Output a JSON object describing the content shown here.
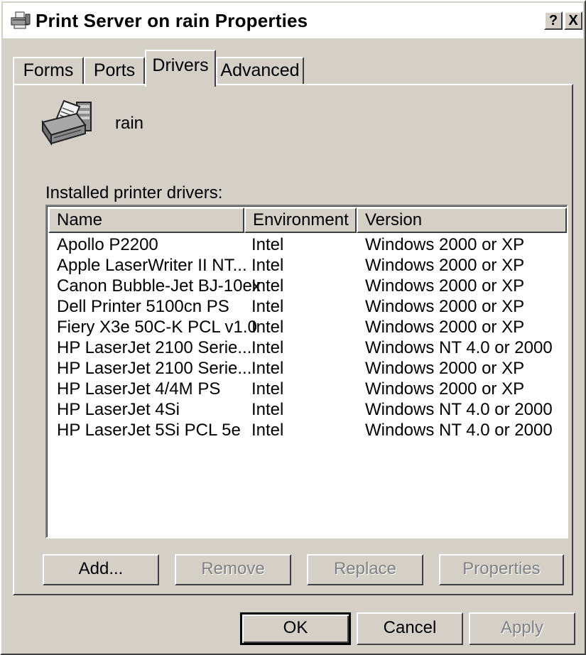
{
  "window": {
    "title": "Print Server on rain Properties",
    "help_label": "?",
    "close_label": "X"
  },
  "tabs": [
    {
      "label": "Forms",
      "active": false
    },
    {
      "label": "Ports",
      "active": false
    },
    {
      "label": "Drivers",
      "active": true
    },
    {
      "label": "Advanced",
      "active": false
    }
  ],
  "server": {
    "name": "rain"
  },
  "drivers": {
    "label": "Installed printer drivers:",
    "columns": [
      "Name",
      "Environment",
      "Version"
    ],
    "rows": [
      {
        "name": "Apollo P2200",
        "environment": "Intel",
        "version": "Windows 2000 or XP"
      },
      {
        "name": "Apple LaserWriter II NT...",
        "environment": "Intel",
        "version": "Windows 2000 or XP"
      },
      {
        "name": "Canon Bubble-Jet BJ-10ex",
        "environment": "Intel",
        "version": "Windows 2000 or XP"
      },
      {
        "name": "Dell Printer 5100cn PS",
        "environment": "Intel",
        "version": "Windows 2000 or XP"
      },
      {
        "name": "Fiery X3e 50C-K PCL v1.0",
        "environment": "Intel",
        "version": "Windows 2000 or XP"
      },
      {
        "name": "HP LaserJet 2100 Serie...",
        "environment": "Intel",
        "version": "Windows NT 4.0 or 2000"
      },
      {
        "name": "HP LaserJet 2100 Serie...",
        "environment": "Intel",
        "version": "Windows 2000 or XP"
      },
      {
        "name": "HP LaserJet 4/4M PS",
        "environment": "Intel",
        "version": "Windows 2000 or XP"
      },
      {
        "name": "HP LaserJet 4Si",
        "environment": "Intel",
        "version": "Windows NT 4.0 or 2000"
      },
      {
        "name": "HP LaserJet 5Si PCL 5e",
        "environment": "Intel",
        "version": "Windows NT 4.0 or 2000"
      }
    ]
  },
  "panel_buttons": {
    "add": "Add...",
    "remove": "Remove",
    "replace": "Replace",
    "properties": "Properties"
  },
  "dialog_buttons": {
    "ok": "OK",
    "cancel": "Cancel",
    "apply": "Apply"
  },
  "colors": {
    "face": "#d4d0c8",
    "highlight": "#ffffff",
    "shadow": "#404040",
    "disabled_text": "#808080"
  },
  "icons": {
    "title": "printer-server-icon",
    "server": "printer-icon"
  }
}
